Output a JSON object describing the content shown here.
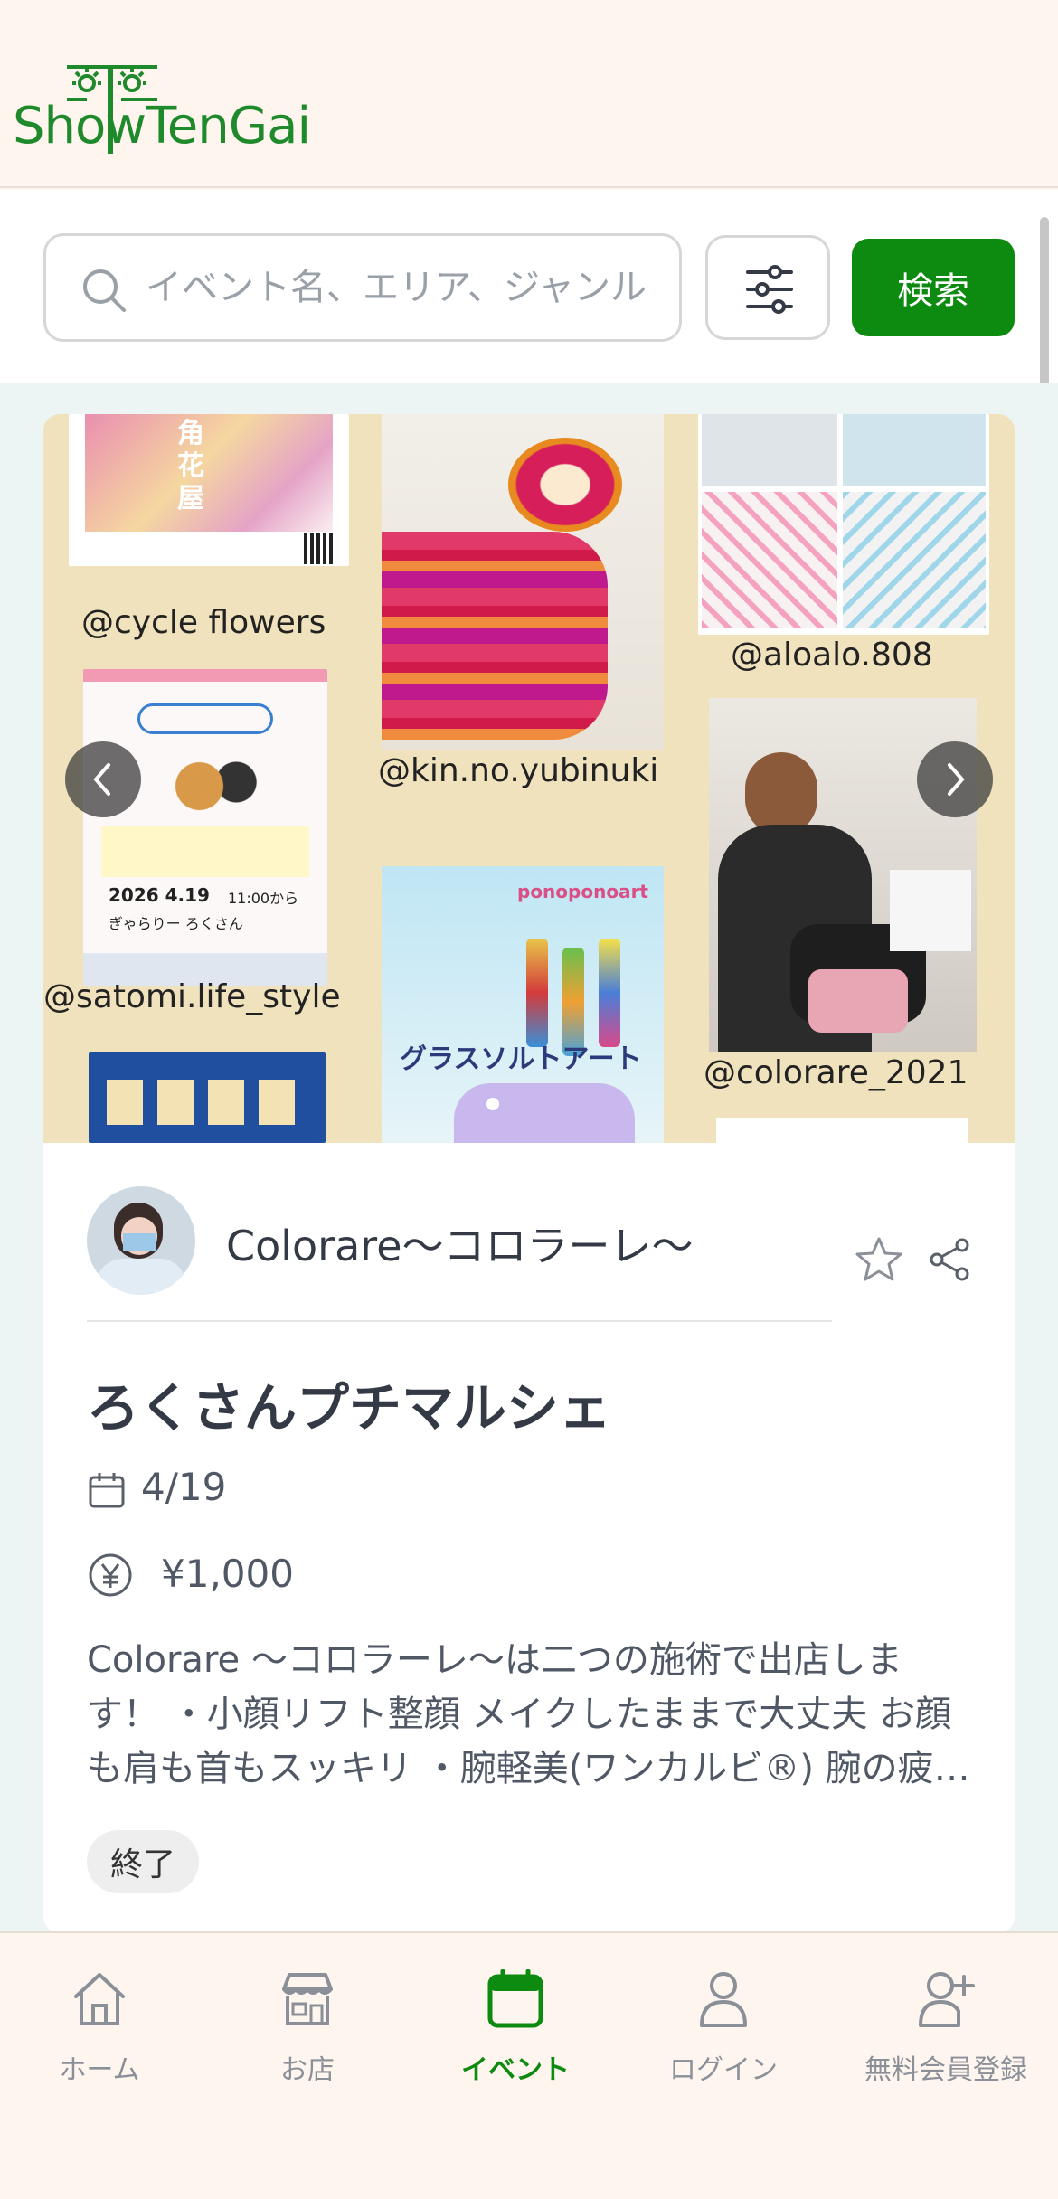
{
  "header": {
    "logo_text": "ShowTenGai"
  },
  "search": {
    "placeholder": "イベント名、エリア、ジャンル",
    "button_label": "検索"
  },
  "carousel": {
    "labels": [
      "@cycle flowers",
      "@kin.no.yubinuki",
      "@aloalo.808",
      "@satomi.life_style",
      "@colorare_2021"
    ],
    "poster_text": {
      "flower_title": "角花屋",
      "date": "2026 4.19",
      "time": "11:00から",
      "venue": "ぎゃらりー ろくさん",
      "craft_brand": "ponoponoart",
      "craft_title": "グラスソルトアート"
    }
  },
  "card": {
    "shop_name": "Colorare〜コロラーレ〜",
    "title": "ろくさんプチマルシェ",
    "date": "4/19",
    "price": "¥1,000",
    "description": "Colorare 〜コロラーレ〜は二つの施術で出店します！ ・小顔リフト整顔 メイクしたままで大丈夫 お顔も肩も首もスッキリ ・腕軽美(ワンカルビ®) 腕の疲れやコリをほぐします",
    "status": "終了"
  },
  "bottom_nav": {
    "items": [
      {
        "label": "ホーム",
        "icon": "home-icon"
      },
      {
        "label": "お店",
        "icon": "store-icon"
      },
      {
        "label": "イベント",
        "icon": "calendar-icon"
      },
      {
        "label": "ログイン",
        "icon": "user-icon"
      },
      {
        "label": "無料会員登録",
        "icon": "user-plus-icon"
      }
    ],
    "active_index": 2
  },
  "colors": {
    "brand_green": "#0d8a10",
    "logo_green": "#1f8a2c",
    "header_bg": "#fdf5ee"
  }
}
